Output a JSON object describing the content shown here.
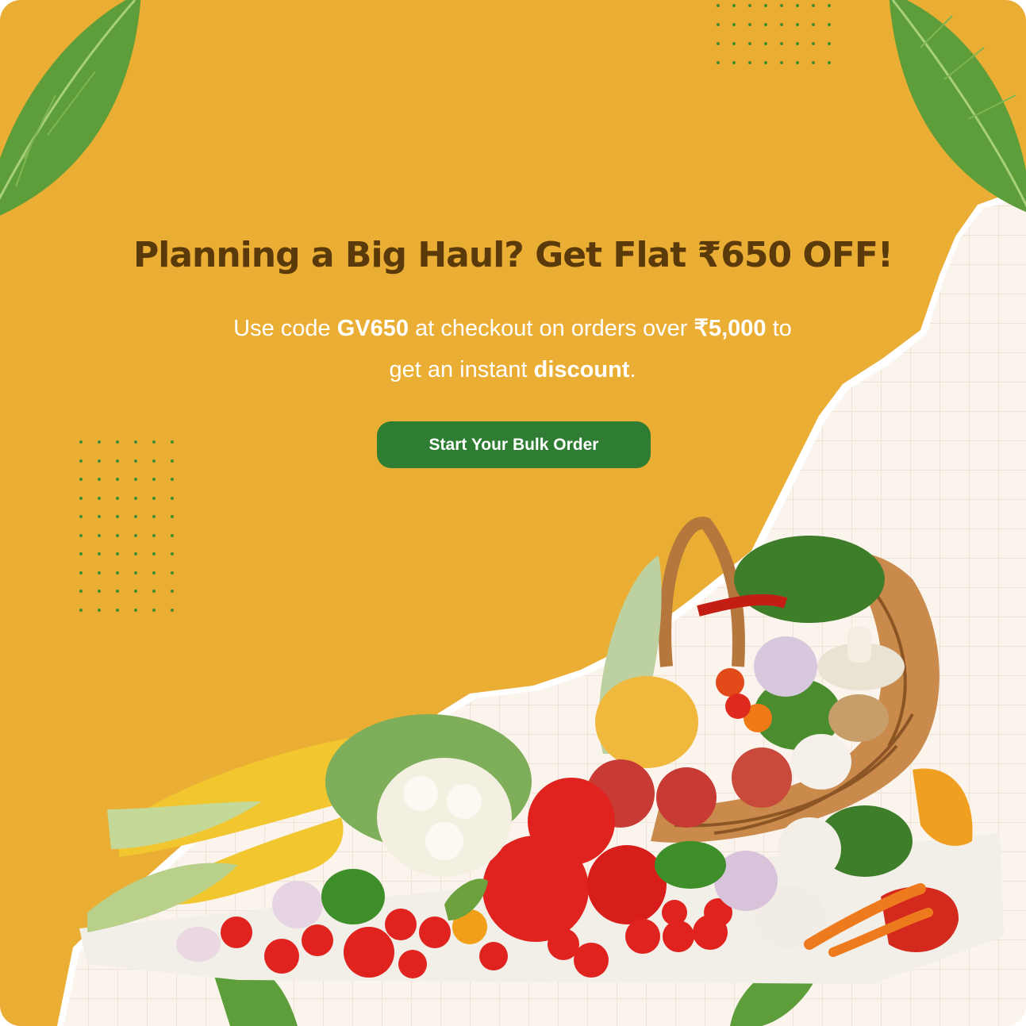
{
  "promo": {
    "headline": "Planning a Big Haul? Get Flat ₹650 OFF!",
    "line1_pre": "Use code ",
    "code": "GV650",
    "line1_mid": " at checkout on orders over ",
    "threshold": "₹5,000",
    "line1_post": " to",
    "line2_pre": "get an instant ",
    "line2_bold": "discount",
    "line2_post": ".",
    "cta_label": "Start Your Bulk Order"
  },
  "colors": {
    "background": "#EBAE34",
    "headline": "#5A3A0A",
    "cta": "#2E7D32",
    "paper": "#FBF4EC",
    "grid": "#EFE3D6",
    "dots": "#3E8E2F"
  },
  "decorations": {
    "leaf_icon": "leaf-icon",
    "dot_pattern": "dot-grid-icon",
    "produce_art": "vegetable-basket-illustration"
  }
}
